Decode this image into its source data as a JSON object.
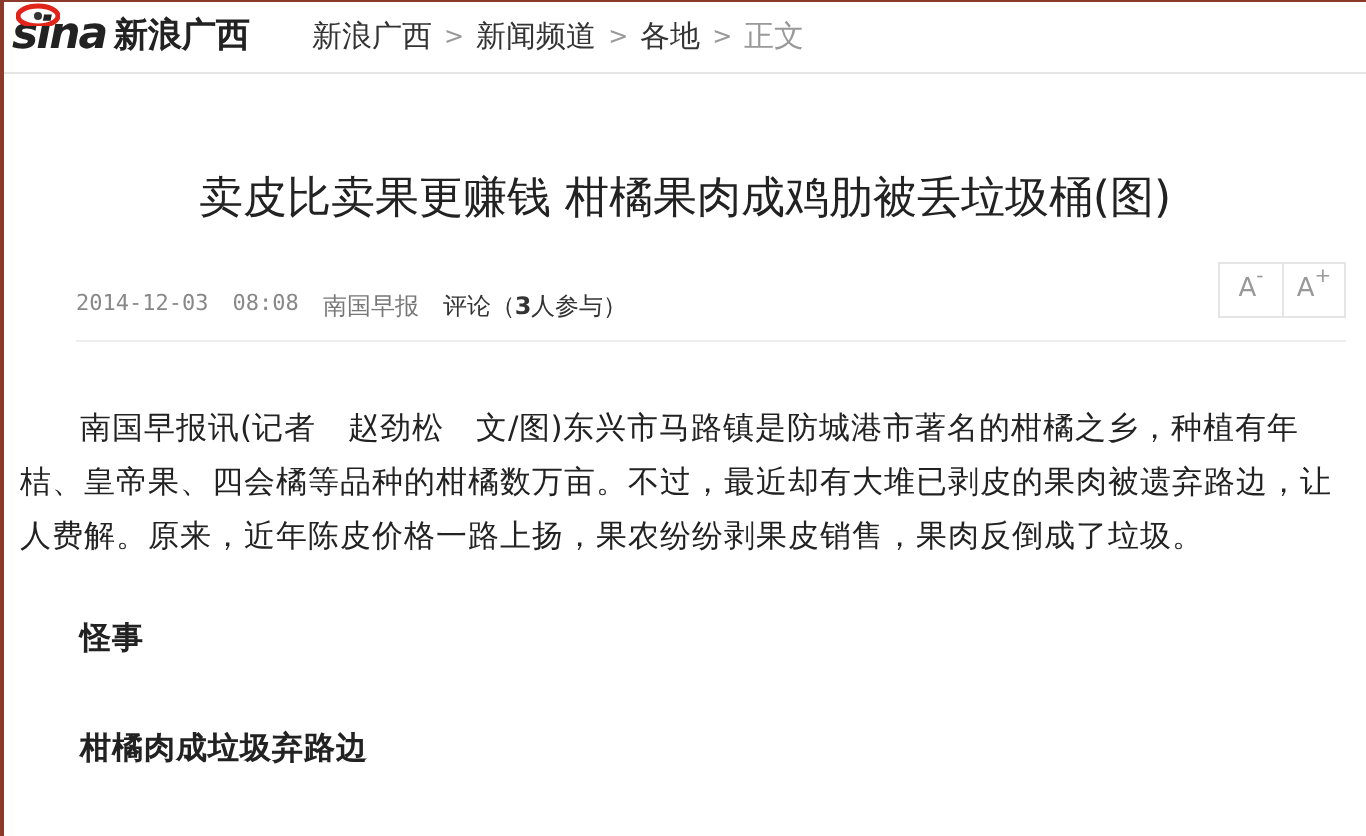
{
  "header": {
    "logo": "sina",
    "site_name": "新浪广西",
    "breadcrumb": [
      {
        "label": "新浪广西",
        "link": true
      },
      {
        "label": "新闻频道",
        "link": true
      },
      {
        "label": "各地",
        "link": true
      },
      {
        "label": "正文",
        "link": false
      }
    ],
    "separator": ">"
  },
  "article": {
    "title": "卖皮比卖果更赚钱 柑橘果肉成鸡肋被丢垃圾桶(图)",
    "date": "2014-12-03",
    "time": "08:08",
    "source": "南国早报",
    "comments": "评论（**3**人参与）",
    "font_buttons": [
      {
        "label": "A",
        "sup": "-"
      },
      {
        "label": "A",
        "sup": "+"
      }
    ],
    "body": [
      {
        "kind": "paragraph",
        "text": "南国早报讯(记者　赵劲松　文/图)东兴市马路镇是防城港市著名的柑橘之乡，种植有年桔、皇帝果、四会橘等品种的柑橘数万亩。不过，最近却有大堆已剥皮的果肉被遗弃路边，让人费解。原来，近年陈皮价格一路上扬，果农纷纷剥果皮销售，果肉反倒成了垃圾。"
      },
      {
        "kind": "heading",
        "text": "怪事"
      },
      {
        "kind": "heading",
        "text": "柑橘肉成垃圾弃路边"
      }
    ]
  }
}
